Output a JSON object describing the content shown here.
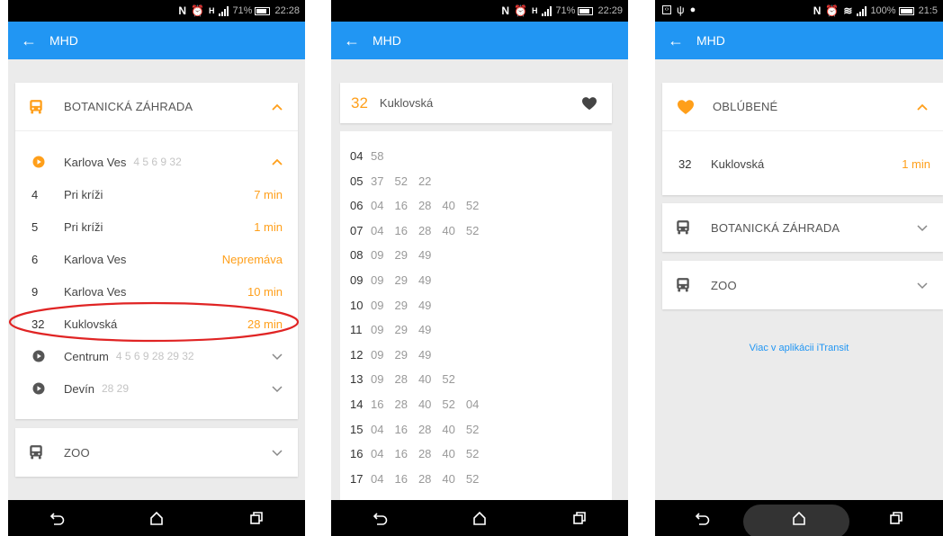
{
  "screens": [
    {
      "status": {
        "percent": "71%",
        "time": "22:28"
      },
      "appbar": {
        "title": "MHD"
      },
      "stop_card": {
        "name": "BOTANICKÁ ZÁHRADA",
        "directions": [
          {
            "name": "Karlova Ves",
            "lines": "4 5 6 9 32",
            "expanded": true
          },
          {
            "name": "Centrum",
            "lines": "4 5 6 9 28 29 32",
            "expanded": false
          },
          {
            "name": "Devín",
            "lines": "28 29",
            "expanded": false
          }
        ],
        "departures": [
          {
            "line": "4",
            "destination": "Pri kríži",
            "time": "7 min"
          },
          {
            "line": "5",
            "destination": "Pri kríži",
            "time": "1 min"
          },
          {
            "line": "6",
            "destination": "Karlova Ves",
            "time": "Nepremáva"
          },
          {
            "line": "9",
            "destination": "Karlova Ves",
            "time": "10 min"
          },
          {
            "line": "32",
            "destination": "Kuklovská",
            "time": "28 min"
          }
        ]
      },
      "zoo_card": {
        "name": "ZOO"
      }
    },
    {
      "status": {
        "percent": "71%",
        "time": "22:29"
      },
      "appbar": {
        "title": "MHD"
      },
      "route": {
        "line": "32",
        "destination": "Kuklovská"
      },
      "schedule": [
        {
          "hour": "04",
          "minutes": [
            "58"
          ]
        },
        {
          "hour": "05",
          "minutes": [
            "37",
            "52",
            "22"
          ]
        },
        {
          "hour": "06",
          "minutes": [
            "04",
            "16",
            "28",
            "40",
            "52"
          ]
        },
        {
          "hour": "07",
          "minutes": [
            "04",
            "16",
            "28",
            "40",
            "52"
          ]
        },
        {
          "hour": "08",
          "minutes": [
            "09",
            "29",
            "49"
          ]
        },
        {
          "hour": "09",
          "minutes": [
            "09",
            "29",
            "49"
          ]
        },
        {
          "hour": "10",
          "minutes": [
            "09",
            "29",
            "49"
          ]
        },
        {
          "hour": "11",
          "minutes": [
            "09",
            "29",
            "49"
          ]
        },
        {
          "hour": "12",
          "minutes": [
            "09",
            "29",
            "49"
          ]
        },
        {
          "hour": "13",
          "minutes": [
            "09",
            "28",
            "40",
            "52"
          ]
        },
        {
          "hour": "14",
          "minutes": [
            "16",
            "28",
            "40",
            "52",
            "04"
          ]
        },
        {
          "hour": "15",
          "minutes": [
            "04",
            "16",
            "28",
            "40",
            "52"
          ]
        },
        {
          "hour": "16",
          "minutes": [
            "04",
            "16",
            "28",
            "40",
            "52"
          ]
        },
        {
          "hour": "17",
          "minutes": [
            "04",
            "16",
            "28",
            "40",
            "52"
          ]
        }
      ]
    },
    {
      "status": {
        "percent": "100%",
        "time": "21:5"
      },
      "appbar": {
        "title": "MHD"
      },
      "favorites": {
        "title": "OBLÚBENÉ",
        "items": [
          {
            "line": "32",
            "destination": "Kuklovská",
            "time": "1 min"
          }
        ]
      },
      "stops": [
        "BOTANICKÁ ZÁHRADA",
        "ZOO"
      ],
      "more_link": "Viac v aplikácii iTransit"
    }
  ],
  "colors": {
    "accent": "#ff9f1a",
    "appbar": "#2196f3",
    "highlight": "#e02424"
  }
}
